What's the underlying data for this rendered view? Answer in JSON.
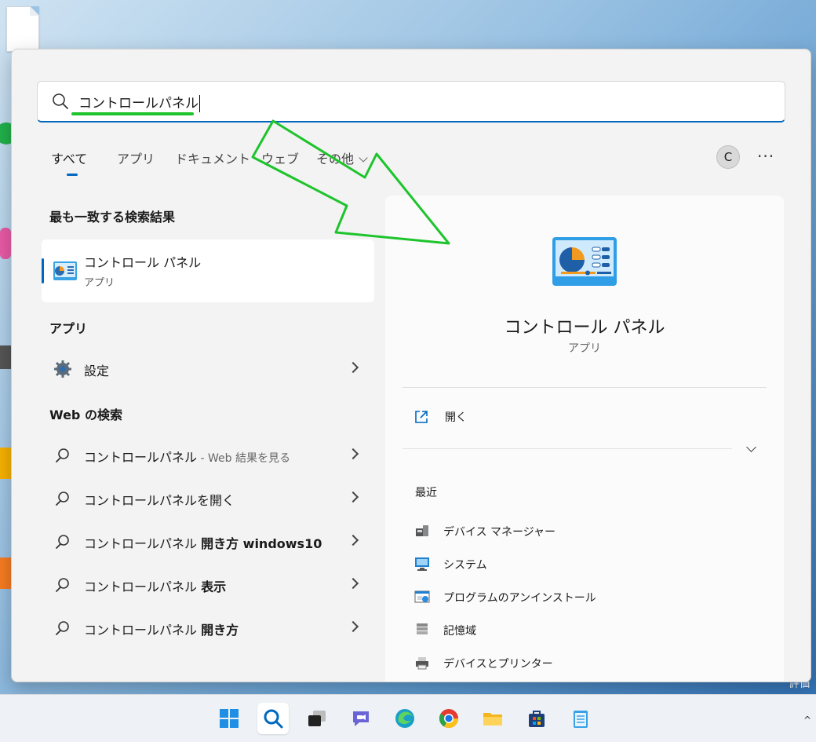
{
  "search": {
    "query": "コントロールパネル"
  },
  "tabs": [
    {
      "label": "すべて",
      "active": true
    },
    {
      "label": "アプリ"
    },
    {
      "label": "ドキュメント"
    },
    {
      "label": "ウェブ"
    },
    {
      "label": "その他"
    }
  ],
  "account": {
    "initial": "C"
  },
  "more_menu": "···",
  "best_match": {
    "heading": "最も一致する検索結果",
    "title": "コントロール パネル",
    "subtitle": "アプリ"
  },
  "apps": {
    "heading": "アプリ",
    "items": [
      {
        "label": "設定"
      }
    ]
  },
  "web": {
    "heading": "Web の検索",
    "items": [
      {
        "text": "コントロールパネル",
        "suffix": " - Web 結果を見る"
      },
      {
        "text": "コントロールパネルを開く",
        "bold": ""
      },
      {
        "text": "コントロールパネル ",
        "bold": "開き方 windows10"
      },
      {
        "text": "コントロールパネル ",
        "bold": "表示"
      },
      {
        "text": "コントロールパネル ",
        "bold": "開き方"
      }
    ]
  },
  "detail": {
    "title": "コントロール パネル",
    "subtitle": "アプリ",
    "open_label": "開く",
    "recent_heading": "最近",
    "recent": [
      {
        "label": "デバイス マネージャー",
        "icon": "device-manager-icon"
      },
      {
        "label": "システム",
        "icon": "system-icon"
      },
      {
        "label": "プログラムのアンインストール",
        "icon": "uninstall-icon"
      },
      {
        "label": "記憶域",
        "icon": "storage-icon"
      },
      {
        "label": "デバイスとプリンター",
        "icon": "printer-icon"
      }
    ]
  },
  "desktop": {
    "corner_label": "評価"
  },
  "colors": {
    "accent": "#0067c0",
    "annotation": "#1ec42c"
  }
}
